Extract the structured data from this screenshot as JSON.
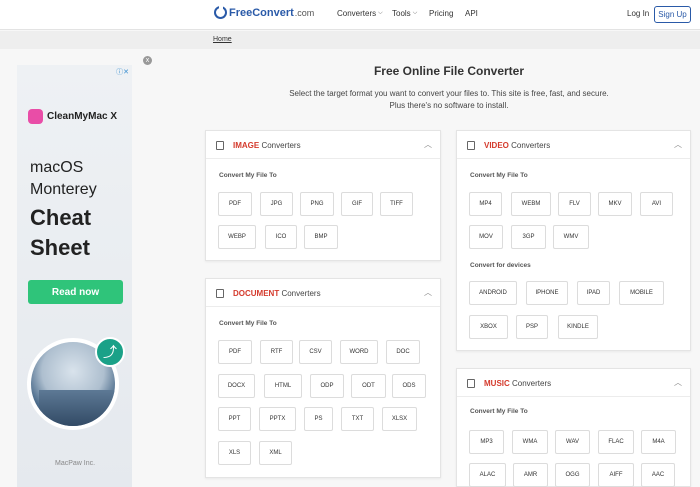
{
  "header": {
    "logo_name": "FreeConvert",
    "logo_tld": ".com",
    "nav": {
      "converters": "Converters",
      "tools": "Tools",
      "pricing": "Pricing",
      "api": "API"
    },
    "login": "Log In",
    "signup": "Sign Up"
  },
  "breadcrumb": "Home",
  "ad": {
    "close": "x",
    "choices": "ⓘ✕",
    "brand": "CleanMyMac X",
    "line1": "macOS",
    "line2": "Monterey",
    "line3": "Cheat",
    "line4": "Sheet",
    "cta": "Read now",
    "footer": "MacPaw Inc."
  },
  "page": {
    "title": "Free Online File Converter",
    "description": "Select the target format you want to convert your files to. This site is free, fast, and secure. Plus there's no software to install."
  },
  "cards": {
    "image": {
      "keyword": "IMAGE",
      "suffix": " Converters",
      "sub": "Convert My File To",
      "formats": [
        "PDF",
        "JPG",
        "PNG",
        "GIF",
        "TIFF",
        "WEBP",
        "ICO",
        "BMP"
      ]
    },
    "document": {
      "keyword": "DOCUMENT",
      "suffix": " Converters",
      "sub": "Convert My File To",
      "formats": [
        "PDF",
        "RTF",
        "CSV",
        "WORD",
        "DOC",
        "DOCX",
        "HTML",
        "ODP",
        "ODT",
        "ODS",
        "PPT",
        "PPTX",
        "PS",
        "TXT",
        "XLSX",
        "XLS",
        "XML"
      ]
    },
    "video": {
      "keyword": "VIDEO",
      "suffix": " Converters",
      "sub": "Convert My File To",
      "formats": [
        "MP4",
        "WEBM",
        "FLV",
        "MKV",
        "AVI",
        "MOV",
        "3GP",
        "WMV"
      ],
      "devices_sub": "Convert for devices",
      "devices": [
        "ANDROID",
        "IPHONE",
        "IPAD",
        "MOBILE",
        "XBOX",
        "PSP",
        "KINDLE"
      ]
    },
    "music": {
      "keyword": "MUSIC",
      "suffix": " Converters",
      "sub": "Convert My File To",
      "formats": [
        "MP3",
        "WMA",
        "WAV",
        "FLAC",
        "M4A",
        "ALAC",
        "AMR",
        "OGG",
        "AIFF",
        "AAC"
      ]
    }
  }
}
